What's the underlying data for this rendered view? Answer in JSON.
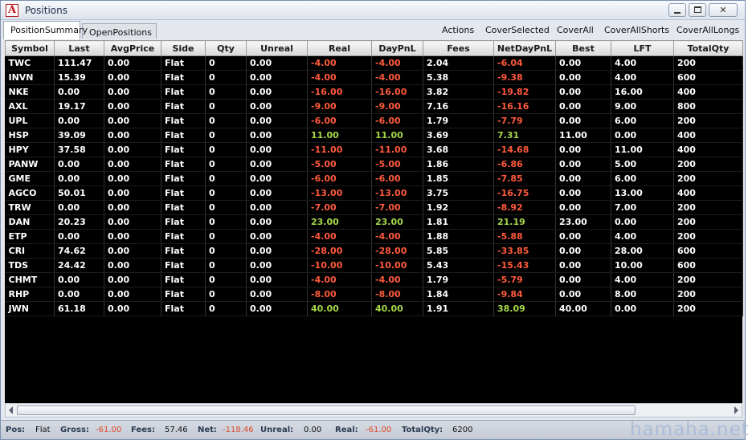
{
  "window": {
    "title": "Positions",
    "icon_letter": "A"
  },
  "tabs": {
    "summary": "PositionSummary",
    "open": "OpenPositions"
  },
  "actions": {
    "actions": "Actions",
    "cover_selected": "CoverSelected",
    "cover_all": "CoverAll",
    "cover_all_shorts": "CoverAllShorts",
    "cover_all_longs": "CoverAllLongs"
  },
  "grid": {
    "columns": [
      "Symbol",
      "Last",
      "AvgPrice",
      "Side",
      "Qty",
      "Unreal",
      "Real",
      "DayPnL",
      "Fees",
      "NetDayPnL",
      "Best",
      "LFT",
      "TotalQty"
    ],
    "rows": [
      [
        "TWC",
        "111.47",
        "0.00",
        "Flat",
        "0",
        "0.00",
        "-4.00",
        "-4.00",
        "2.04",
        "-6.04",
        "0.00",
        "4.00",
        "200"
      ],
      [
        "INVN",
        "15.39",
        "0.00",
        "Flat",
        "0",
        "0.00",
        "-4.00",
        "-4.00",
        "5.38",
        "-9.38",
        "0.00",
        "4.00",
        "600"
      ],
      [
        "NKE",
        "0.00",
        "0.00",
        "Flat",
        "0",
        "0.00",
        "-16.00",
        "-16.00",
        "3.82",
        "-19.82",
        "0.00",
        "16.00",
        "400"
      ],
      [
        "AXL",
        "19.17",
        "0.00",
        "Flat",
        "0",
        "0.00",
        "-9.00",
        "-9.00",
        "7.16",
        "-16.16",
        "0.00",
        "9.00",
        "800"
      ],
      [
        "UPL",
        "0.00",
        "0.00",
        "Flat",
        "0",
        "0.00",
        "-6.00",
        "-6.00",
        "1.79",
        "-7.79",
        "0.00",
        "6.00",
        "200"
      ],
      [
        "HSP",
        "39.09",
        "0.00",
        "Flat",
        "0",
        "0.00",
        "11.00",
        "11.00",
        "3.69",
        "7.31",
        "11.00",
        "0.00",
        "400"
      ],
      [
        "HPY",
        "37.58",
        "0.00",
        "Flat",
        "0",
        "0.00",
        "-11.00",
        "-11.00",
        "3.68",
        "-14.68",
        "0.00",
        "11.00",
        "400"
      ],
      [
        "PANW",
        "0.00",
        "0.00",
        "Flat",
        "0",
        "0.00",
        "-5.00",
        "-5.00",
        "1.86",
        "-6.86",
        "0.00",
        "5.00",
        "200"
      ],
      [
        "GME",
        "0.00",
        "0.00",
        "Flat",
        "0",
        "0.00",
        "-6.00",
        "-6.00",
        "1.85",
        "-7.85",
        "0.00",
        "6.00",
        "200"
      ],
      [
        "AGCO",
        "50.01",
        "0.00",
        "Flat",
        "0",
        "0.00",
        "-13.00",
        "-13.00",
        "3.75",
        "-16.75",
        "0.00",
        "13.00",
        "400"
      ],
      [
        "TRW",
        "0.00",
        "0.00",
        "Flat",
        "0",
        "0.00",
        "-7.00",
        "-7.00",
        "1.92",
        "-8.92",
        "0.00",
        "7.00",
        "200"
      ],
      [
        "DAN",
        "20.23",
        "0.00",
        "Flat",
        "0",
        "0.00",
        "23.00",
        "23.00",
        "1.81",
        "21.19",
        "23.00",
        "0.00",
        "200"
      ],
      [
        "ETP",
        "0.00",
        "0.00",
        "Flat",
        "0",
        "0.00",
        "-4.00",
        "-4.00",
        "1.88",
        "-5.88",
        "0.00",
        "4.00",
        "200"
      ],
      [
        "CRI",
        "74.62",
        "0.00",
        "Flat",
        "0",
        "0.00",
        "-28.00",
        "-28.00",
        "5.85",
        "-33.85",
        "0.00",
        "28.00",
        "600"
      ],
      [
        "TDS",
        "24.42",
        "0.00",
        "Flat",
        "0",
        "0.00",
        "-10.00",
        "-10.00",
        "5.43",
        "-15.43",
        "0.00",
        "10.00",
        "600"
      ],
      [
        "CHMT",
        "0.00",
        "0.00",
        "Flat",
        "0",
        "0.00",
        "-4.00",
        "-4.00",
        "1.79",
        "-5.79",
        "0.00",
        "4.00",
        "200"
      ],
      [
        "RHP",
        "0.00",
        "0.00",
        "Flat",
        "0",
        "0.00",
        "-8.00",
        "-8.00",
        "1.84",
        "-9.84",
        "0.00",
        "8.00",
        "200"
      ],
      [
        "JWN",
        "61.18",
        "0.00",
        "Flat",
        "0",
        "0.00",
        "40.00",
        "40.00",
        "1.91",
        "38.09",
        "40.00",
        "0.00",
        "200"
      ]
    ],
    "colors": {
      "background": "#000000",
      "text": "#ffffff",
      "negative": "#ff5a3c",
      "positive": "#a6d84a"
    }
  },
  "statusbar": {
    "pos_label": "Pos:",
    "pos_value": "Flat",
    "gross_label": "Gross:",
    "gross_value": "-61.00",
    "fees_label": "Fees:",
    "fees_value": "57.46",
    "net_label": "Net:",
    "net_value": "-118.46",
    "unreal_label": "Unreal:",
    "unreal_value": "0.00",
    "real_label": "Real:",
    "real_value": "-61.00",
    "totalqty_label": "TotalQty:",
    "totalqty_value": "6200"
  },
  "watermark": "hamaha.net"
}
